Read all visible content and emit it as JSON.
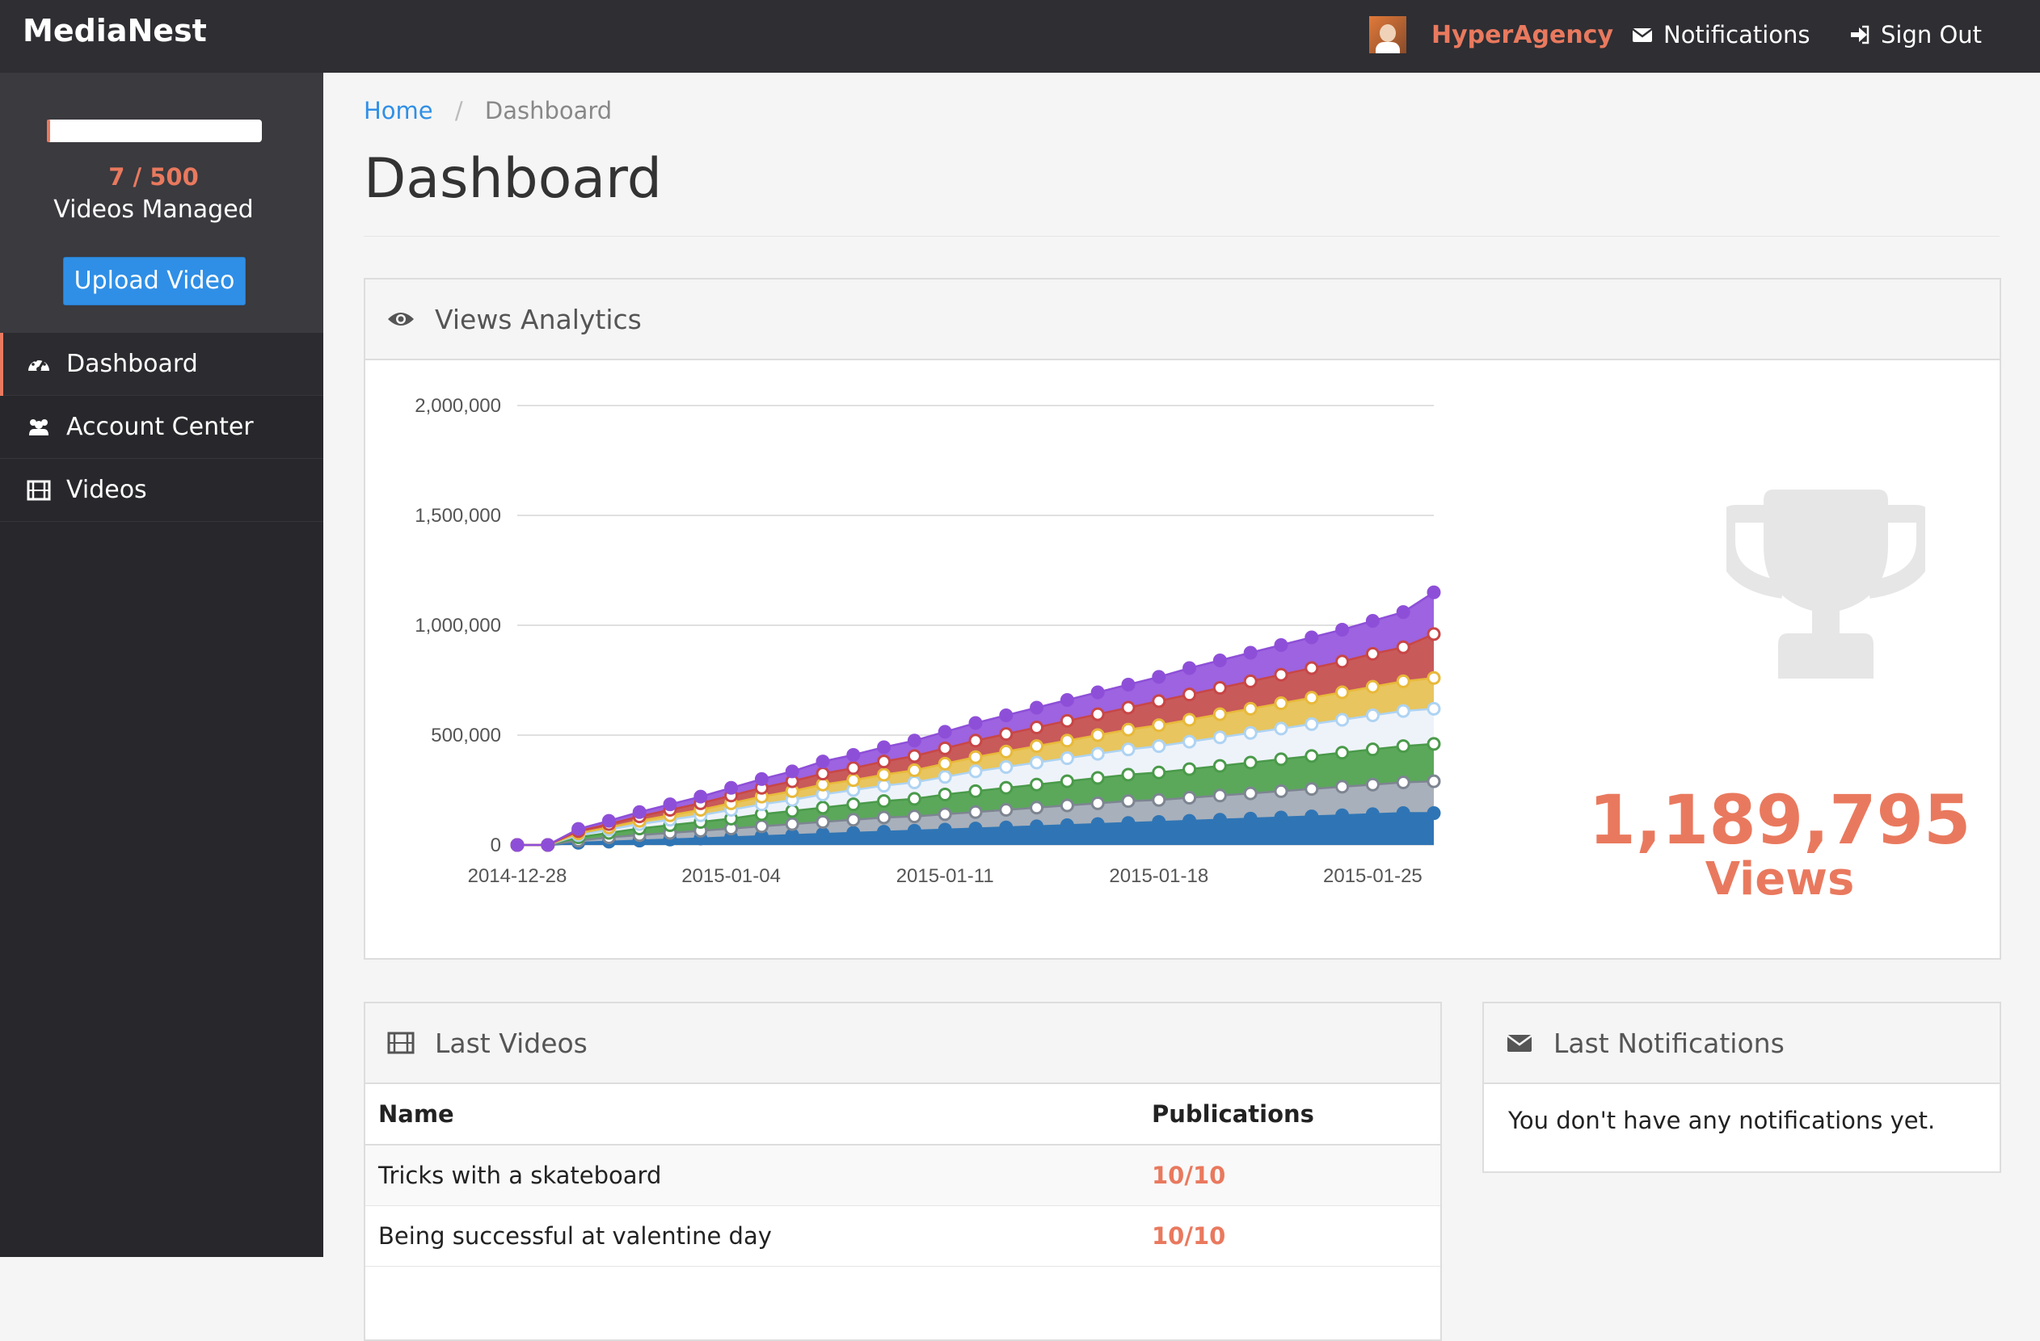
{
  "app": {
    "brand": "MediaNest"
  },
  "navbar": {
    "user": "HyperAgency",
    "notifications": "Notifications",
    "sign_out": "Sign Out"
  },
  "sidebar": {
    "progress_fraction": 0.014,
    "count": "7 / 500",
    "managed_label": "Videos Managed",
    "upload_button": "Upload Video",
    "items": [
      {
        "label": "Dashboard",
        "icon": "dashboard-icon",
        "active": true
      },
      {
        "label": "Account Center",
        "icon": "users-icon",
        "active": false
      },
      {
        "label": "Videos",
        "icon": "film-icon",
        "active": false
      }
    ]
  },
  "breadcrumb": {
    "home": "Home",
    "separator": "/",
    "current": "Dashboard"
  },
  "page": {
    "title": "Dashboard"
  },
  "analytics": {
    "title": "Views Analytics",
    "total": "1,189,795",
    "total_label": "Views"
  },
  "chart_data": {
    "type": "area",
    "stacked": true,
    "x_start": "2014-12-28",
    "x_ticks": [
      "2014-12-28",
      "2015-01-04",
      "2015-01-11",
      "2015-01-18",
      "2015-01-25"
    ],
    "y_ticks": [
      "0",
      "500,000",
      "1,000,000",
      "1,500,000",
      "2,000,000"
    ],
    "ylim": [
      0,
      2000000
    ],
    "num_points": 31,
    "grid": true,
    "legend": "none",
    "series": [
      {
        "color": "#2f75b5",
        "values": [
          0,
          0,
          10000,
          15000,
          20000,
          25000,
          30000,
          35000,
          40000,
          45000,
          50000,
          55000,
          60000,
          65000,
          70000,
          75000,
          80000,
          85000,
          90000,
          95000,
          100000,
          105000,
          110000,
          115000,
          120000,
          125000,
          130000,
          135000,
          140000,
          145000,
          145000
        ]
      },
      {
        "color": "#a8b0bb",
        "values": [
          0,
          0,
          10000,
          20000,
          25000,
          30000,
          35000,
          40000,
          45000,
          50000,
          55000,
          60000,
          65000,
          65000,
          70000,
          75000,
          80000,
          85000,
          90000,
          95000,
          100000,
          100000,
          105000,
          110000,
          115000,
          120000,
          125000,
          130000,
          135000,
          140000,
          145000
        ]
      },
      {
        "color": "#5ba85b",
        "values": [
          0,
          0,
          15000,
          20000,
          30000,
          35000,
          40000,
          45000,
          55000,
          60000,
          65000,
          70000,
          75000,
          80000,
          90000,
          95000,
          100000,
          105000,
          110000,
          115000,
          120000,
          125000,
          130000,
          135000,
          140000,
          145000,
          150000,
          155000,
          160000,
          165000,
          170000
        ]
      },
      {
        "color": "#eef3fa",
        "values": [
          0,
          0,
          10000,
          15000,
          20000,
          25000,
          30000,
          40000,
          45000,
          50000,
          60000,
          65000,
          70000,
          75000,
          80000,
          90000,
          95000,
          100000,
          105000,
          110000,
          115000,
          120000,
          125000,
          130000,
          135000,
          140000,
          145000,
          150000,
          155000,
          160000,
          160000
        ]
      },
      {
        "color": "#e8c55e",
        "values": [
          0,
          0,
          8000,
          10000,
          15000,
          20000,
          25000,
          30000,
          35000,
          40000,
          45000,
          45000,
          50000,
          55000,
          60000,
          65000,
          70000,
          75000,
          80000,
          85000,
          90000,
          95000,
          100000,
          105000,
          110000,
          115000,
          120000,
          125000,
          130000,
          135000,
          140000
        ]
      },
      {
        "color": "#c85a5a",
        "values": [
          0,
          0,
          10000,
          15000,
          20000,
          25000,
          30000,
          35000,
          40000,
          45000,
          50000,
          55000,
          60000,
          65000,
          70000,
          75000,
          80000,
          85000,
          90000,
          95000,
          100000,
          110000,
          115000,
          120000,
          125000,
          130000,
          135000,
          140000,
          150000,
          155000,
          200000
        ]
      },
      {
        "color": "#9d63e0",
        "values": [
          0,
          0,
          10000,
          15000,
          20000,
          25000,
          30000,
          35000,
          40000,
          45000,
          55000,
          60000,
          65000,
          70000,
          75000,
          80000,
          85000,
          90000,
          95000,
          100000,
          105000,
          110000,
          120000,
          125000,
          130000,
          135000,
          140000,
          145000,
          150000,
          160000,
          190000
        ]
      }
    ],
    "dot_colors": [
      "#2f75b5",
      "#7d8591",
      "#4a9a4a",
      "#aed3f2",
      "#e8b93a",
      "#c84646",
      "#8e4fd8"
    ]
  },
  "videos": {
    "title": "Last Videos",
    "columns": [
      "Name",
      "Publications"
    ],
    "rows": [
      {
        "name": "Tricks with a skateboard",
        "publications": "10/10"
      },
      {
        "name": "Being successful at valentine day",
        "publications": "10/10"
      }
    ]
  },
  "notifications_panel": {
    "title": "Last Notifications",
    "empty": "You don't have any notifications yet."
  }
}
